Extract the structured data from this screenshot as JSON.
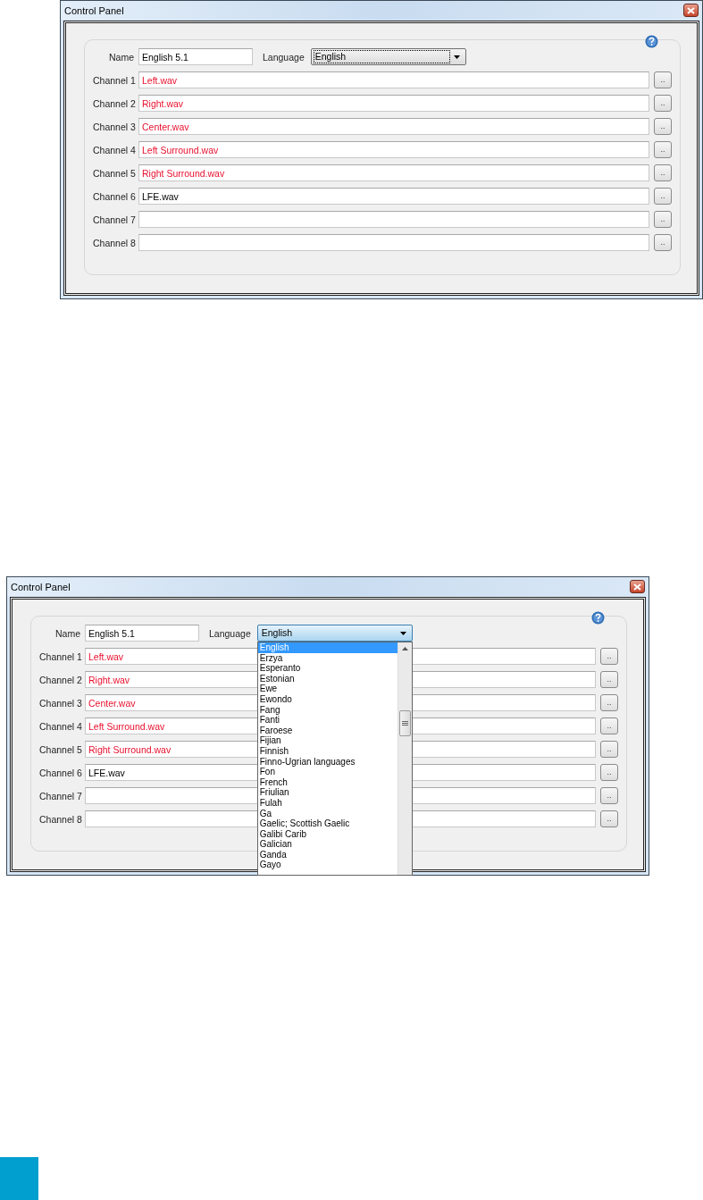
{
  "windows": [
    {
      "title": "Control Panel",
      "name_label": "Name",
      "name_value": "English 5.1",
      "language_label": "Language",
      "language_value": "English",
      "language_focused": true,
      "language_open": false,
      "channels": [
        {
          "label": "Channel 1",
          "value": "Left.wav",
          "flagged": true,
          "button": ".."
        },
        {
          "label": "Channel 2",
          "value": "Right.wav",
          "flagged": true,
          "button": ".."
        },
        {
          "label": "Channel 3",
          "value": "Center.wav",
          "flagged": true,
          "button": ".."
        },
        {
          "label": "Channel 4",
          "value": "Left Surround.wav",
          "flagged": true,
          "button": ".."
        },
        {
          "label": "Channel 5",
          "value": "Right Surround.wav",
          "flagged": true,
          "button": ".."
        },
        {
          "label": "Channel 6",
          "value": "LFE.wav",
          "flagged": false,
          "button": ".."
        },
        {
          "label": "Channel 7",
          "button": ".."
        },
        {
          "label": "Channel 8",
          "button": ".."
        }
      ]
    },
    {
      "title": "Control Panel",
      "name_label": "Name",
      "name_value": "English 5.1",
      "language_label": "Language",
      "language_value": "English",
      "language_focused": false,
      "language_open": true,
      "language_options": [
        {
          "label": "English",
          "selected": true
        },
        {
          "label": "Erzya",
          "selected": false
        },
        {
          "label": "Esperanto",
          "selected": false
        },
        {
          "label": "Estonian",
          "selected": false
        },
        {
          "label": "Ewe",
          "selected": false
        },
        {
          "label": "Ewondo",
          "selected": false
        },
        {
          "label": "Fang",
          "selected": false
        },
        {
          "label": "Fanti",
          "selected": false
        },
        {
          "label": "Faroese",
          "selected": false
        },
        {
          "label": "Fijian",
          "selected": false
        },
        {
          "label": "Finnish",
          "selected": false
        },
        {
          "label": "Finno-Ugrian languages",
          "selected": false
        },
        {
          "label": "Fon",
          "selected": false
        },
        {
          "label": "French",
          "selected": false
        },
        {
          "label": "Friulian",
          "selected": false
        },
        {
          "label": "Fulah",
          "selected": false
        },
        {
          "label": "Ga",
          "selected": false
        },
        {
          "label": "Gaelic; Scottish Gaelic",
          "selected": false
        },
        {
          "label": "Galibi Carib",
          "selected": false
        },
        {
          "label": "Galician",
          "selected": false
        },
        {
          "label": "Ganda",
          "selected": false
        },
        {
          "label": "Gayo",
          "selected": false
        }
      ],
      "channels": [
        {
          "label": "Channel 1",
          "value": "Left.wav",
          "flagged": true,
          "button": ".."
        },
        {
          "label": "Channel 2",
          "value": "Right.wav",
          "flagged": true,
          "button": ".."
        },
        {
          "label": "Channel 3",
          "value": "Center.wav",
          "flagged": true,
          "button": ".."
        },
        {
          "label": "Channel 4",
          "value": "Left Surround.wav",
          "flagged": true,
          "button": ".."
        },
        {
          "label": "Channel 5",
          "value": "Right Surround.wav",
          "flagged": true,
          "button": ".."
        },
        {
          "label": "Channel 6",
          "value": "LFE.wav",
          "flagged": false,
          "button": ".."
        },
        {
          "label": "Channel 7",
          "button": ".."
        },
        {
          "label": "Channel 8",
          "button": ".."
        }
      ]
    }
  ]
}
